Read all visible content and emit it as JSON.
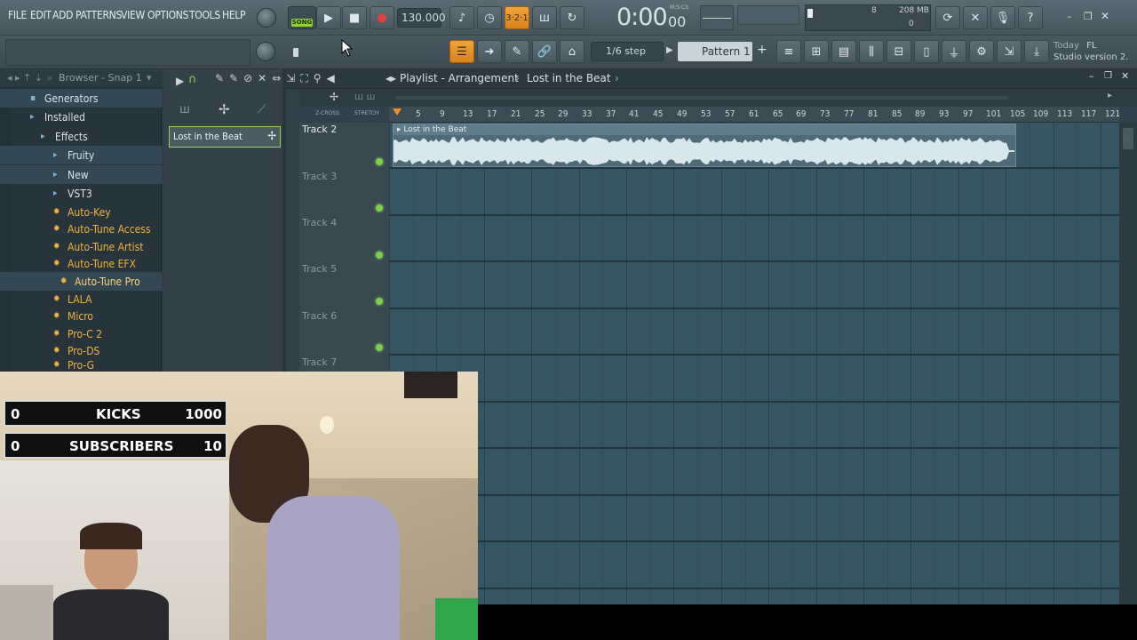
{
  "menu": [
    "FILE",
    "EDIT",
    "ADD",
    "PATTERNS",
    "VIEW",
    "OPTIONS",
    "TOOLS",
    "HELP"
  ],
  "transport": {
    "mode_label": "SONG",
    "tempo": "130.000",
    "time": "0:00",
    "time_sub": "00",
    "time_unit": "M:S:CS"
  },
  "status": {
    "memory": "208 MB",
    "voices": "8",
    "cpu": "0"
  },
  "snap": {
    "step": "1/6 step",
    "pattern": "Pattern 1"
  },
  "news": {
    "line1": "Today",
    "line1b": "FL",
    "line2": "Studio version 2."
  },
  "browser": {
    "title": "Browser - Snap 1",
    "items": [
      {
        "label": "Generators",
        "type": "folder"
      },
      {
        "label": "Installed",
        "type": "folder"
      },
      {
        "label": "Effects",
        "type": "folder"
      },
      {
        "label": "Fruity",
        "type": "folder"
      },
      {
        "label": "New",
        "type": "folder"
      },
      {
        "label": "VST3",
        "type": "folder"
      },
      {
        "label": "Auto-Key",
        "type": "plugin"
      },
      {
        "label": "Auto-Tune Access",
        "type": "plugin"
      },
      {
        "label": "Auto-Tune Artist",
        "type": "plugin"
      },
      {
        "label": "Auto-Tune EFX",
        "type": "plugin"
      },
      {
        "label": "Auto-Tune Pro",
        "type": "plugin"
      },
      {
        "label": "LALA",
        "type": "plugin"
      },
      {
        "label": "Micro",
        "type": "plugin"
      },
      {
        "label": "Pro-C 2",
        "type": "plugin"
      },
      {
        "label": "Pro-DS",
        "type": "plugin"
      },
      {
        "label": "Pro-G",
        "type": "plugin"
      }
    ]
  },
  "channel": {
    "clip_name": "Lost in the Beat"
  },
  "playlist": {
    "title": "Playlist - Arrangement",
    "crumb": "Lost in the Beat",
    "zcross": "Z-CROSS",
    "stretch": "STRETCH",
    "ruler": [
      "5",
      "9",
      "13",
      "17",
      "21",
      "25",
      "29",
      "33",
      "37",
      "41",
      "45",
      "49",
      "53",
      "57",
      "61",
      "65",
      "69",
      "73",
      "77",
      "81",
      "85",
      "89",
      "93",
      "97",
      "101",
      "105",
      "109",
      "113",
      "117",
      "121"
    ],
    "tracks": [
      "Track 2",
      "Track 3",
      "Track 4",
      "Track 5",
      "Track 6",
      "Track 7"
    ],
    "clip_title": "Lost in the Beat"
  },
  "overlay": {
    "kicks": {
      "count": "0",
      "label": "KICKS",
      "goal": "1000"
    },
    "subs": {
      "count": "0",
      "label": "SUBSCRIBERS",
      "goal": "10"
    }
  }
}
